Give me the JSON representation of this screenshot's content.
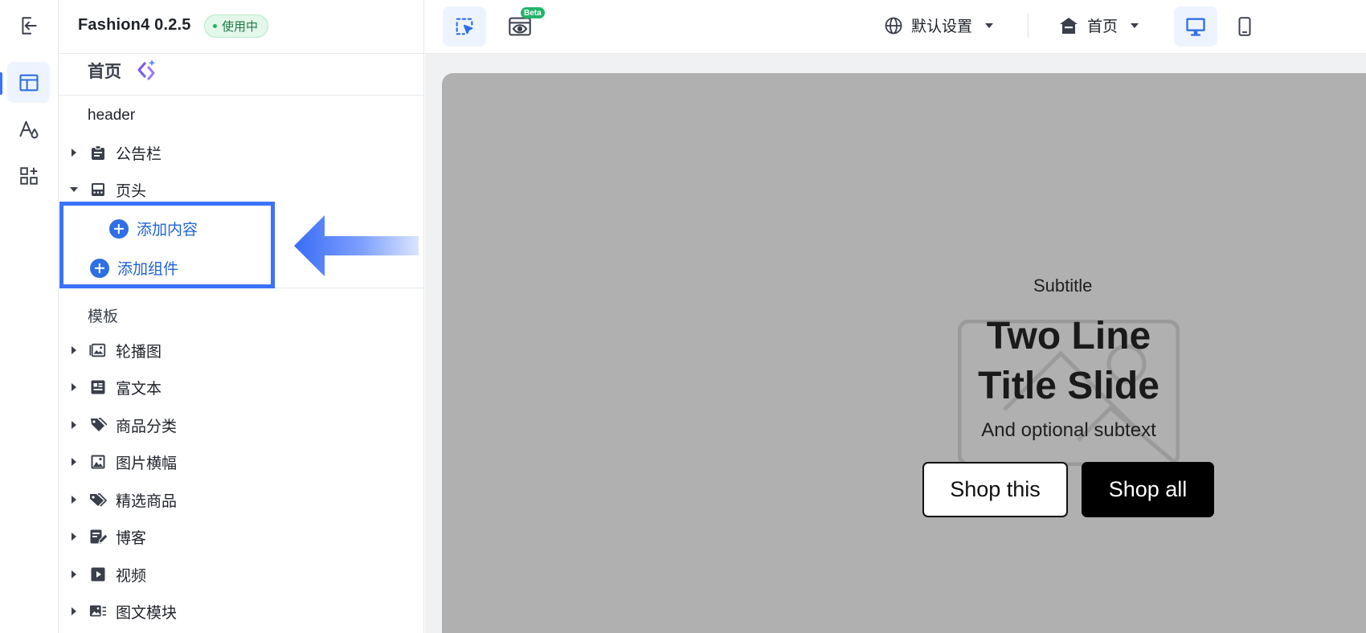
{
  "header": {
    "app_name": "Fashion4 0.2.5",
    "status_badge": "使用中"
  },
  "sidebar": {
    "page_title": "首页",
    "sections": {
      "header_label": "header",
      "template_label": "模板"
    },
    "header_items": [
      {
        "label": "公告栏",
        "icon": "announcement-icon",
        "expanded": false
      },
      {
        "label": "页头",
        "icon": "page-header-icon",
        "expanded": true
      }
    ],
    "add_content_label": "添加内容",
    "add_component_label": "添加组件",
    "template_items": [
      {
        "label": "轮播图",
        "icon": "carousel-icon"
      },
      {
        "label": "富文本",
        "icon": "rich-text-icon"
      },
      {
        "label": "商品分类",
        "icon": "product-category-icon"
      },
      {
        "label": "图片横幅",
        "icon": "image-banner-icon"
      },
      {
        "label": "精选商品",
        "icon": "featured-products-icon"
      },
      {
        "label": "博客",
        "icon": "blog-icon"
      },
      {
        "label": "视频",
        "icon": "video-icon"
      },
      {
        "label": "图文模块",
        "icon": "image-text-icon"
      }
    ]
  },
  "toolbar": {
    "beta_label": "Beta",
    "language_label": "默认设置",
    "page_select_label": "首页"
  },
  "preview": {
    "subtitle": "Subtitle",
    "title": "Two Line Title Slide",
    "subtext": "And optional subtext",
    "primary_button": "Shop this",
    "secondary_button": "Shop all"
  },
  "colors": {
    "accent": "#3a72ff",
    "badge_bg": "#e3f7ea",
    "canvas_bg": "#b0b0b0"
  }
}
